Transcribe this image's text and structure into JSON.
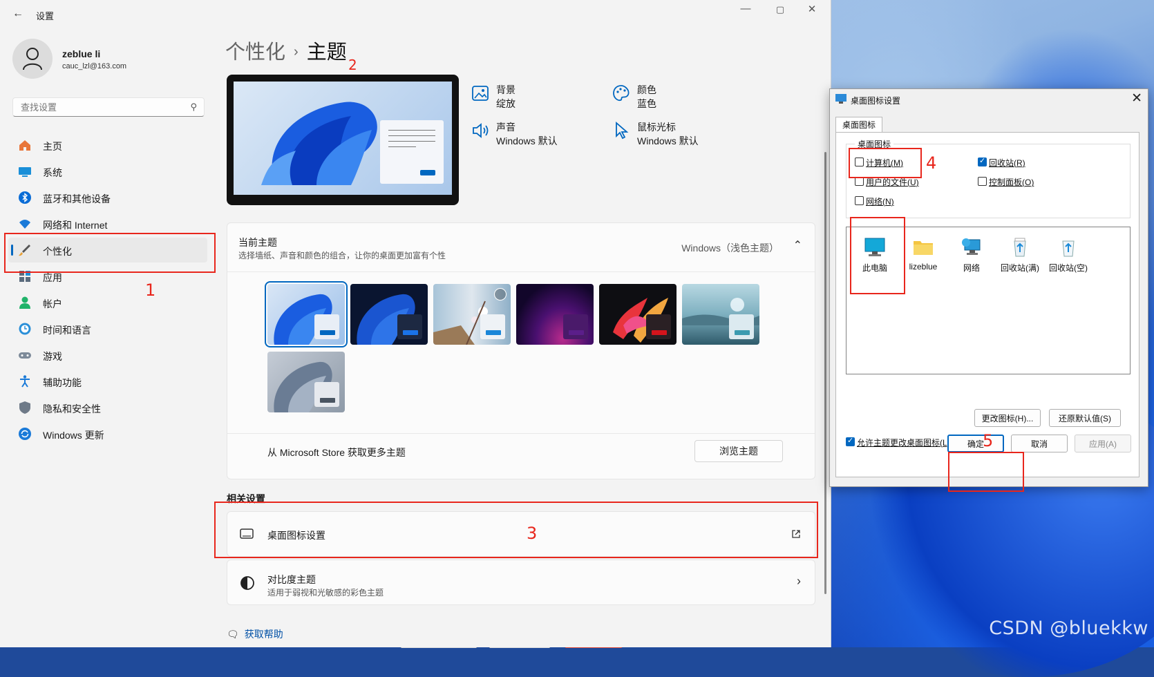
{
  "window": {
    "title": "设置",
    "back_icon": "arrow-left-icon",
    "minimize": "—",
    "maximize": "▢",
    "close": "✕"
  },
  "profile": {
    "name": "zeblue li",
    "email": "cauc_lzl@163.com"
  },
  "search": {
    "placeholder": "查找设置"
  },
  "nav": [
    {
      "label": "主页",
      "icon": "home-icon"
    },
    {
      "label": "系统",
      "icon": "monitor-icon"
    },
    {
      "label": "蓝牙和其他设备",
      "icon": "bluetooth-icon"
    },
    {
      "label": "网络和 Internet",
      "icon": "wifi-icon"
    },
    {
      "label": "个性化",
      "icon": "brush-icon",
      "active": true
    },
    {
      "label": "应用",
      "icon": "apps-icon"
    },
    {
      "label": "帐户",
      "icon": "user-icon"
    },
    {
      "label": "时间和语言",
      "icon": "clock-globe-icon"
    },
    {
      "label": "游戏",
      "icon": "gamepad-icon"
    },
    {
      "label": "辅助功能",
      "icon": "accessibility-icon"
    },
    {
      "label": "隐私和安全性",
      "icon": "shield-icon"
    },
    {
      "label": "Windows 更新",
      "icon": "refresh-icon"
    }
  ],
  "breadcrumb": {
    "parent": "个性化",
    "separator": "›",
    "current": "主题"
  },
  "quick_settings": [
    {
      "title": "背景",
      "value": "绽放",
      "icon": "image-icon"
    },
    {
      "title": "颜色",
      "value": "蓝色",
      "icon": "palette-icon"
    },
    {
      "title": "声音",
      "value": "Windows 默认",
      "icon": "speaker-icon"
    },
    {
      "title": "鼠标光标",
      "value": "Windows 默认",
      "icon": "cursor-icon"
    }
  ],
  "current_theme": {
    "title": "当前主题",
    "subtitle": "选择墙纸、声音和颜色的组合，让你的桌面更加富有个性",
    "value": "Windows（浅色主题）",
    "chevron": "⌃"
  },
  "theme_tiles": [
    {
      "name": "windows-light",
      "accent": "#0067c0",
      "selected": true
    },
    {
      "name": "windows-dark",
      "accent": "#1a73e8"
    },
    {
      "name": "glow",
      "accent": "#1a86d8"
    },
    {
      "name": "captured-motion",
      "accent": "#5b1e8a"
    },
    {
      "name": "flow",
      "accent": "#d4141c"
    },
    {
      "name": "sunrise",
      "accent": "#3a9ab0"
    },
    {
      "name": "bloom-silver",
      "accent": "#4a5562"
    }
  ],
  "store": {
    "label": "从 Microsoft Store 获取更多主题",
    "button": "浏览主题"
  },
  "related": {
    "title": "相关设置",
    "desktop_icons": {
      "title": "桌面图标设置",
      "icon": "open-external-icon"
    },
    "contrast": {
      "title": "对比度主题",
      "subtitle": "适用于弱视和光敏感的彩色主题",
      "chevron": "›"
    }
  },
  "help": {
    "label": "获取帮助"
  },
  "dialog": {
    "title": "桌面图标设置",
    "close": "✕",
    "tab": "桌面图标",
    "group_label": "桌面图标",
    "checkboxes": [
      {
        "label": "计算机(M)",
        "checked": false
      },
      {
        "label": "回收站(R)",
        "checked": true
      },
      {
        "label": "用户的文件(U)",
        "checked": false
      },
      {
        "label": "控制面板(O)",
        "checked": false
      },
      {
        "label": "网络(N)",
        "checked": false
      }
    ],
    "icons": [
      {
        "label": "此电脑",
        "icon": "this-pc-icon"
      },
      {
        "label": "lizeblue",
        "icon": "user-folder-icon"
      },
      {
        "label": "网络",
        "icon": "network-icon"
      },
      {
        "label": "回收站(满)",
        "icon": "recycle-bin-full-icon"
      },
      {
        "label": "回收站(空)",
        "icon": "recycle-bin-empty-icon"
      }
    ],
    "change_icon": "更改图标(H)...",
    "restore_default": "还原默认值(S)",
    "allow_themes": {
      "label": "允许主题更改桌面图标(L)",
      "checked": true
    },
    "ok": "确定",
    "cancel": "取消",
    "apply": "应用(A)"
  },
  "annotations": [
    "1",
    "2",
    "3",
    "4",
    "5"
  ],
  "watermark": "CSDN @bluekkw",
  "colors": {
    "accent": "#0067c0",
    "annotation_red": "#e8261c",
    "window_bg": "#f3f3f3"
  }
}
